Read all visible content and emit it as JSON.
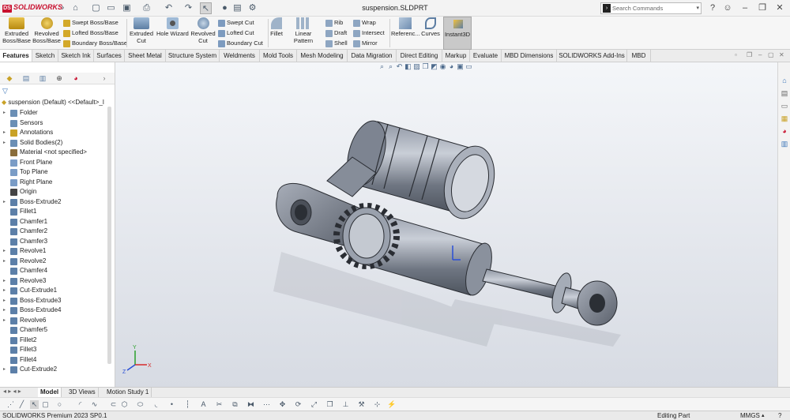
{
  "app": {
    "brand": "SOLIDWORKS",
    "document_title": "suspension.SLDPRT"
  },
  "search": {
    "placeholder": "Search Commands"
  },
  "ribbon": {
    "big": [
      {
        "label": "Extruded\nBoss/Base"
      },
      {
        "label": "Revolved\nBoss/Base"
      },
      {
        "label": "Extruded\nCut"
      },
      {
        "label": "Hole Wizard"
      },
      {
        "label": "Revolved\nCut"
      },
      {
        "label": "Fillet"
      },
      {
        "label": "Linear Pattern"
      },
      {
        "label": "Referenc..."
      },
      {
        "label": "Curves"
      }
    ],
    "small": [
      {
        "label": "Swept Boss/Base"
      },
      {
        "label": "Lofted Boss/Base"
      },
      {
        "label": "Boundary Boss/Base"
      },
      {
        "label": "Swept Cut"
      },
      {
        "label": "Lofted Cut"
      },
      {
        "label": "Boundary Cut"
      },
      {
        "label": "Rib"
      },
      {
        "label": "Draft"
      },
      {
        "label": "Shell"
      },
      {
        "label": "Wrap"
      },
      {
        "label": "Intersect"
      },
      {
        "label": "Mirror"
      }
    ],
    "instant3d": "Instant3D"
  },
  "tabs": [
    "Features",
    "Sketch",
    "Sketch Ink",
    "Surfaces",
    "Sheet Metal",
    "Structure System",
    "Weldments",
    "Mold Tools",
    "Mesh Modeling",
    "Data Migration",
    "Direct Editing",
    "Markup",
    "Evaluate",
    "MBD Dimensions",
    "SOLIDWORKS Add-Ins",
    "MBD"
  ],
  "tree": {
    "root": "suspension (Default) <<Default>_I",
    "items": [
      {
        "label": "Folder",
        "exp": true,
        "color": "#6b8fb5"
      },
      {
        "label": "Sensors",
        "exp": false,
        "color": "#6b8fb5"
      },
      {
        "label": "Annotations",
        "exp": true,
        "color": "#c9a227"
      },
      {
        "label": "Solid Bodies(2)",
        "exp": true,
        "color": "#6b8fb5"
      },
      {
        "label": "Material <not specified>",
        "exp": false,
        "color": "#8a6d3b"
      },
      {
        "label": "Front Plane",
        "exp": false,
        "color": "#7a9cc6"
      },
      {
        "label": "Top Plane",
        "exp": false,
        "color": "#7a9cc6"
      },
      {
        "label": "Right Plane",
        "exp": false,
        "color": "#7a9cc6"
      },
      {
        "label": "Origin",
        "exp": false,
        "color": "#444444"
      },
      {
        "label": "Boss-Extrude2",
        "exp": true,
        "color": "#5c7fa8"
      },
      {
        "label": "Fillet1",
        "exp": false,
        "color": "#5c7fa8"
      },
      {
        "label": "Chamfer1",
        "exp": false,
        "color": "#5c7fa8"
      },
      {
        "label": "Chamfer2",
        "exp": false,
        "color": "#5c7fa8"
      },
      {
        "label": "Chamfer3",
        "exp": false,
        "color": "#5c7fa8"
      },
      {
        "label": "Revolve1",
        "exp": true,
        "color": "#5c7fa8"
      },
      {
        "label": "Revolve2",
        "exp": true,
        "color": "#5c7fa8"
      },
      {
        "label": "Chamfer4",
        "exp": false,
        "color": "#5c7fa8"
      },
      {
        "label": "Revolve3",
        "exp": true,
        "color": "#5c7fa8"
      },
      {
        "label": "Cut-Extrude1",
        "exp": true,
        "color": "#5c7fa8"
      },
      {
        "label": "Boss-Extrude3",
        "exp": true,
        "color": "#5c7fa8"
      },
      {
        "label": "Boss-Extrude4",
        "exp": true,
        "color": "#5c7fa8"
      },
      {
        "label": "Revolve6",
        "exp": true,
        "color": "#5c7fa8"
      },
      {
        "label": "Chamfer5",
        "exp": false,
        "color": "#5c7fa8"
      },
      {
        "label": "Fillet2",
        "exp": false,
        "color": "#5c7fa8"
      },
      {
        "label": "Fillet3",
        "exp": false,
        "color": "#5c7fa8"
      },
      {
        "label": "Fillet4",
        "exp": false,
        "color": "#5c7fa8"
      },
      {
        "label": "Cut-Extrude2",
        "exp": true,
        "color": "#5c7fa8"
      }
    ]
  },
  "triad": {
    "x": "X",
    "y": "Y",
    "z": "Z"
  },
  "bottom_tabs": [
    "Model",
    "3D Views",
    "Motion Study 1"
  ],
  "status": {
    "left": "SOLIDWORKS Premium 2023 SP0.1",
    "mode": "Editing Part",
    "units": "MMGS"
  }
}
